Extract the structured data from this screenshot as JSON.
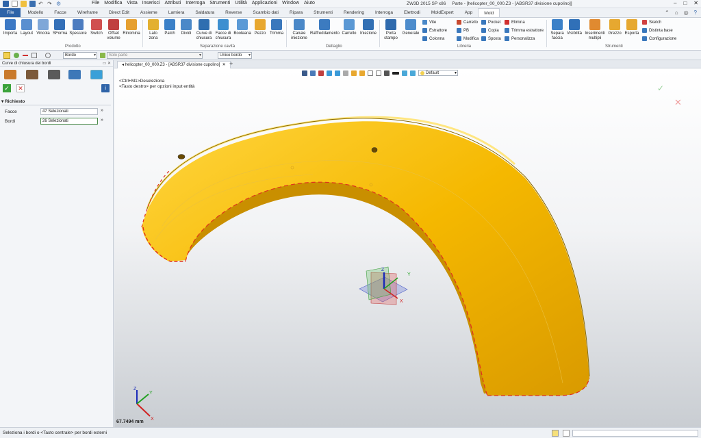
{
  "app": {
    "menu": [
      "File",
      "Modifica",
      "Vista",
      "Inserisci",
      "Attributi",
      "Interroga",
      "Strumenti",
      "Utilità",
      "Applicazioni",
      "Window",
      "Aiuto"
    ],
    "title": "ZW3D 2015 SP x86",
    "doc_title": "Parte - [helicopter_00_000.Z3 - [ABSR37 divisione cupolino]]"
  },
  "tabs": {
    "file": "File",
    "items": [
      "Modello",
      "Facce",
      "Wireframe",
      "Direct Edit",
      "Assieme",
      "Lamiera",
      "Saldatura",
      "Reverse",
      "Scambio dati",
      "Ripara",
      "Strumenti",
      "Rendering",
      "Interroga",
      "Elettrodi",
      "MoldExpert",
      "App"
    ],
    "active": "Mold"
  },
  "ribbon": {
    "prodotto": {
      "label": "Prodotto",
      "buttons": [
        "Importa",
        "Layout",
        "Vincola",
        "SForma",
        "Spessore",
        "Switch",
        "Offset volume",
        "Rinomina"
      ]
    },
    "separazione": {
      "label": "Separazione cavità",
      "buttons": [
        "Lato zona",
        "Patch",
        "Dividi",
        "Curve di chiusura",
        "Facce di chiusura",
        "Booleana",
        "Pezzo",
        "Trimma"
      ]
    },
    "dettaglio": {
      "label": "Dettaglio",
      "buttons": [
        "Canale iniezione",
        "Raffreddamento",
        "Carrello",
        "Iniezione"
      ]
    },
    "libreria": {
      "label": "Libreria",
      "big": [
        "Porta stampo",
        "Generale"
      ],
      "col1": [
        "Vite",
        "Estrattore",
        "Colonna"
      ],
      "col2": [
        "Carrello",
        "PB",
        "Modifica"
      ],
      "col3": [
        "Pocket",
        "Copia",
        "Sposta"
      ],
      "col4": [
        "Elimina",
        "Trimma estrattore",
        "Personalizza"
      ]
    },
    "strumenti": {
      "label": "Strumenti",
      "buttons": [
        "Separa faccia",
        "Visibilità",
        "Inserimenti multipli",
        "Grezzo",
        "Esporta"
      ],
      "small": [
        "Sketch",
        "Distinta base",
        "Configurazione"
      ]
    }
  },
  "toolrow": {
    "filter": "Bordo",
    "solo_parte": "Solo parte",
    "mode": "Unico bordo"
  },
  "panel": {
    "title": "Curve di chiusura dei bordi",
    "section": "Richiesto",
    "facce_label": "Facce",
    "facce_value": "47 Selezionati",
    "bordi_label": "Bordi",
    "bordi_value": "26 Selezionati"
  },
  "doc": {
    "tab": "helicopter_00_000.Z3 - [ABSR37 divisione cupolino]",
    "add": "+"
  },
  "viewport": {
    "hint1": "<Ctrl+M1>Deseleziona",
    "hint2": "<Tasto destro> per opzioni input entità",
    "style": "Default",
    "scale": "67.7494 mm",
    "axis_x": "X",
    "axis_y": "Y",
    "axis_z": "Z"
  },
  "status": {
    "text": "Seleziona i bordi o <Tasto centrale> per bordi esterni"
  },
  "colors": {
    "accent": "#2e63a8",
    "part": "#f5b800",
    "edge_highlight": "#e03020",
    "ok": "#3aa23a",
    "cancel": "#d03030"
  }
}
